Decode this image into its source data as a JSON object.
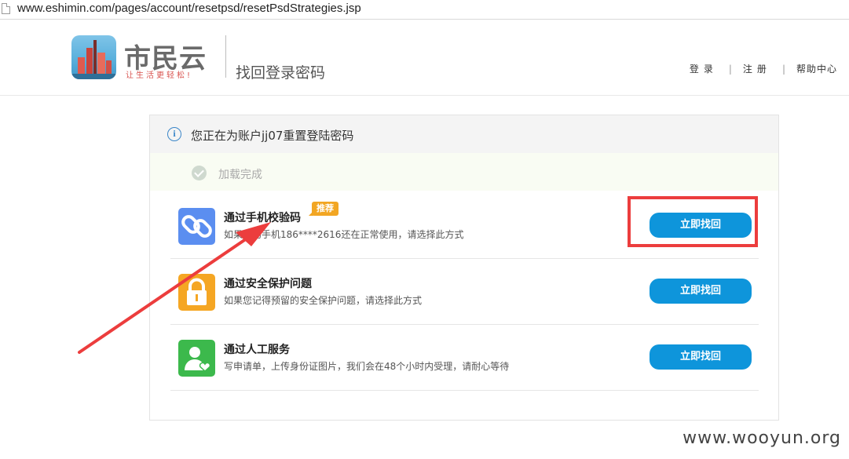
{
  "browser": {
    "url": "www.eshimin.com/pages/account/resetpsd/resetPsdStrategies.jsp"
  },
  "header": {
    "logo_name": "市民云",
    "logo_slogan": "让生活更轻松!",
    "page_heading": "找回登录密码",
    "nav": {
      "login": "登录",
      "register": "注册",
      "help": "帮助中心",
      "separator": "|"
    }
  },
  "card": {
    "notice": "您正在为账户jj07重置登陆密码",
    "loaded_status": "加载完成",
    "options": [
      {
        "title": "通过手机校验码",
        "tag": "推荐",
        "description": "如果您的手机186****2616还在正常使用，请选择此方式",
        "button": "立即找回",
        "icon": "link-icon",
        "color": "#5b8ef0"
      },
      {
        "title": "通过安全保护问题",
        "description": "如果您记得预留的安全保护问题，请选择此方式",
        "button": "立即找回",
        "icon": "lock-icon",
        "color": "#f5a623"
      },
      {
        "title": "通过人工服务",
        "description": "写申请单，上传身份证图片，我们会在48个小时内受理，请耐心等待",
        "button": "立即找回",
        "icon": "user-heart-icon",
        "color": "#3cb94c"
      }
    ]
  },
  "watermark": "www.wooyun.org",
  "colors": {
    "button": "#0e95db",
    "annotation_red": "#ec3d3d",
    "tag": "#f2a623"
  }
}
